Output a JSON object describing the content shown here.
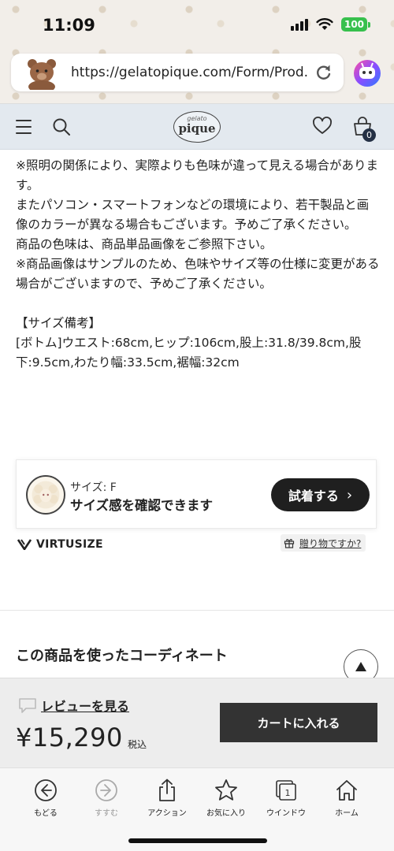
{
  "status_bar": {
    "time": "11:09",
    "battery": "100"
  },
  "browser": {
    "url": "https://gelatopique.com/Form/Prod..."
  },
  "header": {
    "logo_small": "gelato",
    "logo_main": "pique",
    "cart_count": "0"
  },
  "description": {
    "paragraphs": [
      "※照明の関係により、実際よりも色味が違って見える場合があります。",
      "またパソコン・スマートフォンなどの環境により、若干製品と画像のカラーが異なる場合もございます。予めご了承ください。",
      "商品の色味は、商品単品画像をご参照下さい。",
      "※商品画像はサンプルのため、色味やサイズ等の仕様に変更がある場合がございますので、予めご了承ください。"
    ],
    "size_heading": "【サイズ備考】",
    "size_note": "[ボトム]ウエスト:68cm,ヒップ:106cm,股上:31.8/39.8cm,股下:9.5cm,わたり幅:33.5cm,裾幅:32cm"
  },
  "virtusize": {
    "size_label": "サイズ: F",
    "message": "サイズ感を確認できます",
    "button_label": "試着する",
    "brand": "VIRTUSIZE",
    "gift_link": "贈り物ですか?"
  },
  "coordinate": {
    "heading": "この商品を使ったコーディネート"
  },
  "purchase": {
    "review_link": "レビューを見る",
    "price": "¥15,290",
    "tax_label": "税込",
    "cart_button": "カートに入れる"
  },
  "toolbar": {
    "items": [
      {
        "label": "もどる",
        "icon": "back-icon"
      },
      {
        "label": "すすむ",
        "icon": "forward-icon"
      },
      {
        "label": "アクション",
        "icon": "share-icon"
      },
      {
        "label": "お気に入り",
        "icon": "star-icon"
      },
      {
        "label": "ウインドウ",
        "icon": "tabs-icon",
        "count": "1"
      },
      {
        "label": "ホーム",
        "icon": "home-icon"
      }
    ]
  },
  "colors": {
    "header_bg": "#e3e9ef",
    "battery": "#37c04d",
    "cart_button": "#333333",
    "try_button": "#1f1f1f"
  }
}
